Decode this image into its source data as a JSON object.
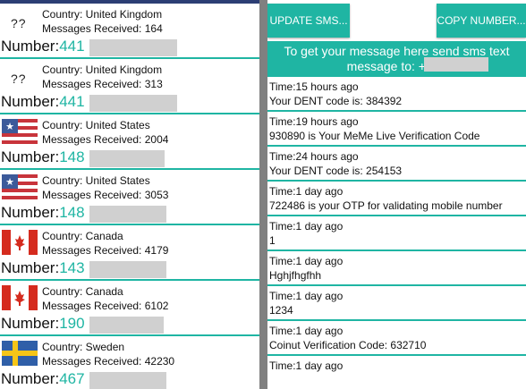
{
  "countries": [
    {
      "flag": "unknown",
      "unknown_text": "??",
      "country": "Country: United Kingdom",
      "messages": "Messages Received: 164",
      "number_label": "Number:",
      "number_prefix": "441"
    },
    {
      "flag": "unknown",
      "unknown_text": "??",
      "country": "Country: United Kingdom",
      "messages": "Messages Received: 313",
      "number_label": "Number:",
      "number_prefix": "441"
    },
    {
      "flag": "us",
      "country": "Country: United States",
      "messages": "Messages Received: 2004",
      "number_label": "Number:",
      "number_prefix": "148"
    },
    {
      "flag": "us",
      "country": "Country: United States",
      "messages": "Messages Received: 3053",
      "number_label": "Number:",
      "number_prefix": "148"
    },
    {
      "flag": "ca",
      "country": "Country: Canada",
      "messages": "Messages Received: 4179",
      "number_label": "Number:",
      "number_prefix": "143"
    },
    {
      "flag": "ca",
      "country": "Country: Canada",
      "messages": "Messages Received: 6102",
      "number_label": "Number:",
      "number_prefix": "190"
    },
    {
      "flag": "se",
      "country": "Country: Sweden",
      "messages": "Messages Received: 42230",
      "number_label": "Number:",
      "number_prefix": "467"
    }
  ],
  "toolbar": {
    "update_label": "UPDATE SMS...",
    "copy_label": "COPY NUMBER..."
  },
  "banner": {
    "line1": "To get your message here send sms text",
    "line2": "message to: +467"
  },
  "messages": [
    {
      "time": "Time:15 hours ago",
      "body": "Your DENT code is: 384392"
    },
    {
      "time": "Time:19 hours ago",
      "body": "930890 is Your MeMe Live Verification Code"
    },
    {
      "time": "Time:24 hours ago",
      "body": "Your DENT code is: 254153"
    },
    {
      "time": "Time:1 day ago",
      "body": "722486 is your OTP for validating mobile number"
    },
    {
      "time": "Time:1 day ago",
      "body": "1"
    },
    {
      "time": "Time:1 day ago",
      "body": "Hghjfhgfhh"
    },
    {
      "time": "Time:1 day ago",
      "body": "1234"
    },
    {
      "time": "Time:1 day ago",
      "body": "Coinut Verification Code: 632710"
    },
    {
      "time": "Time:1 day ago",
      "body": ""
    }
  ],
  "colors": {
    "accent": "#1fb5a3",
    "topbar": "#2c3e74",
    "divider": "#808080",
    "redaction": "#d0d0d0"
  }
}
